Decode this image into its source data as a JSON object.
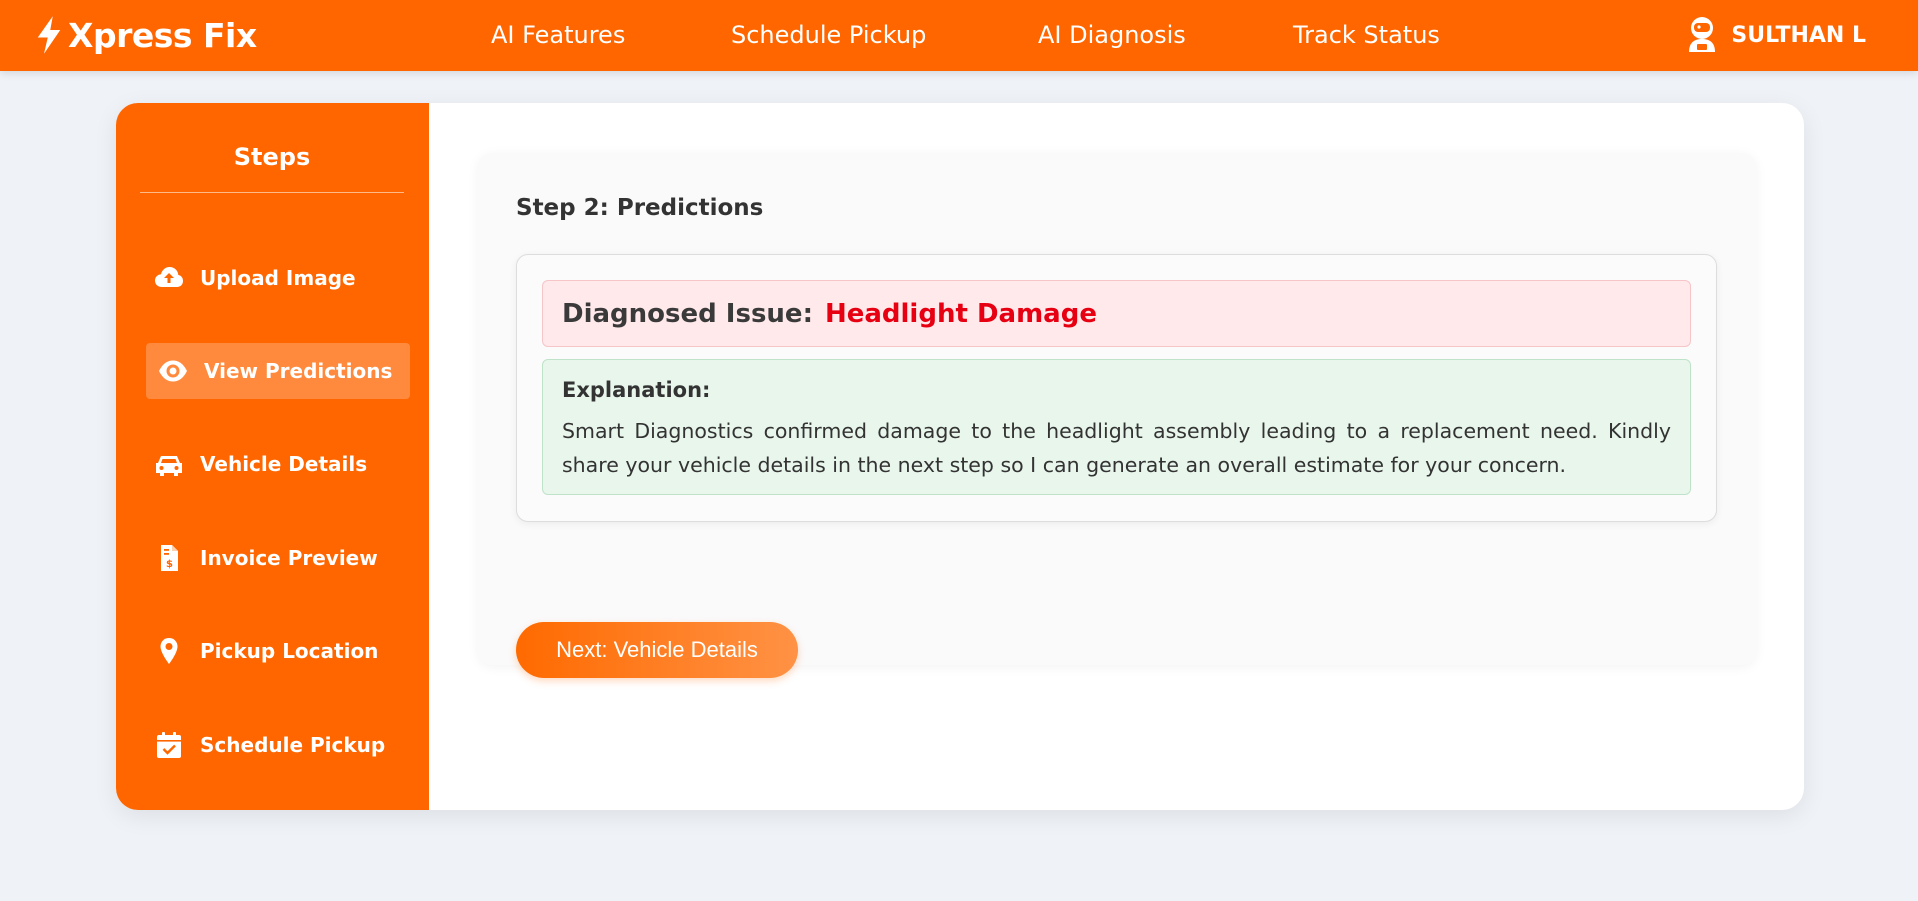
{
  "nav": {
    "brand": "Xpress Fix",
    "links": [
      "AI Features",
      "Schedule Pickup",
      "AI Diagnosis",
      "Track Status"
    ],
    "user": "SULTHAN L"
  },
  "sidebar": {
    "title": "Steps",
    "items": [
      {
        "label": "Upload Image",
        "icon": "cloud-upload-icon"
      },
      {
        "label": "View Predictions",
        "icon": "eye-icon",
        "active": true
      },
      {
        "label": "Vehicle Details",
        "icon": "car-icon"
      },
      {
        "label": "Invoice Preview",
        "icon": "invoice-icon"
      },
      {
        "label": "Pickup Location",
        "icon": "map-pin-icon"
      },
      {
        "label": "Schedule Pickup",
        "icon": "calendar-check-icon"
      }
    ]
  },
  "main": {
    "step_title": "Step 2: Predictions",
    "issue_label": "Diagnosed Issue:",
    "issue_value": "Headlight Damage",
    "explanation_title": "Explanation:",
    "explanation_text": "Smart Diagnostics confirmed damage to the headlight assembly leading to a replacement need. Kindly share your vehicle details in the next step so I can generate an overall estimate for your concern.",
    "next_button": "Next: Vehicle Details"
  },
  "colors": {
    "brand": "#ff6600",
    "active_step": "#ff8a3d",
    "issue_text": "#e60012",
    "issue_bg": "#ffe9ea",
    "explain_bg": "#e8f6ec"
  }
}
